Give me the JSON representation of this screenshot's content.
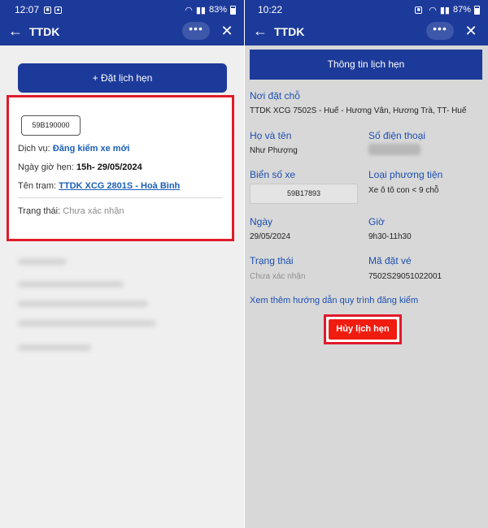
{
  "left": {
    "status": {
      "time": "12:07",
      "battery": "83%"
    },
    "app_title": "TTDK",
    "more_label": "•••",
    "book_button": "+ Đặt lịch hẹn",
    "card": {
      "plate": "59B190000",
      "service_label": "Dịch vụ:",
      "service_value": "Đăng kiểm xe mới",
      "datetime_label": "Ngày giờ hẹn:",
      "datetime_value": "15h- 29/05/2024",
      "station_label": "Tên trạm:",
      "station_value": "TTDK XCG 2801S - Hoà Bình",
      "status_label": "Trạng thái:",
      "status_value": "Chưa xác nhận"
    }
  },
  "right": {
    "status": {
      "time": "10:22",
      "battery": "87%"
    },
    "app_title": "TTDK",
    "more_label": "•••",
    "header": "Thông tin lịch hẹn",
    "place_label": "Nơi đặt chỗ",
    "place_value": "TTDK XCG 7502S - Huế - Hương Vân, Hương Trà, TT- Huế",
    "name_label": "Họ và tên",
    "name_value": "Như Phượng",
    "phone_label": "Số điện thoại",
    "plate_label": "Biển số xe",
    "plate_value": "59B17893",
    "vehicle_type_label": "Loại phương tiện",
    "vehicle_type_value": "Xe ô tô con < 9 chỗ",
    "date_label": "Ngày",
    "date_value": "29/05/2024",
    "time_label": "Giờ",
    "time_value": "9h30-11h30",
    "status_label": "Trạng thái",
    "status_value": "Chưa xác nhận",
    "code_label": "Mã đặt vé",
    "code_value": "7502S29051022001",
    "guide_link": "Xem thêm hướng dẫn quy trình đăng kiểm",
    "cancel_button": "Hủy lịch hẹn"
  },
  "colors": {
    "primary": "#1c3a9a",
    "link": "#1c4fb0",
    "highlight_border": "#e01b2b",
    "cancel": "#f01c10"
  }
}
